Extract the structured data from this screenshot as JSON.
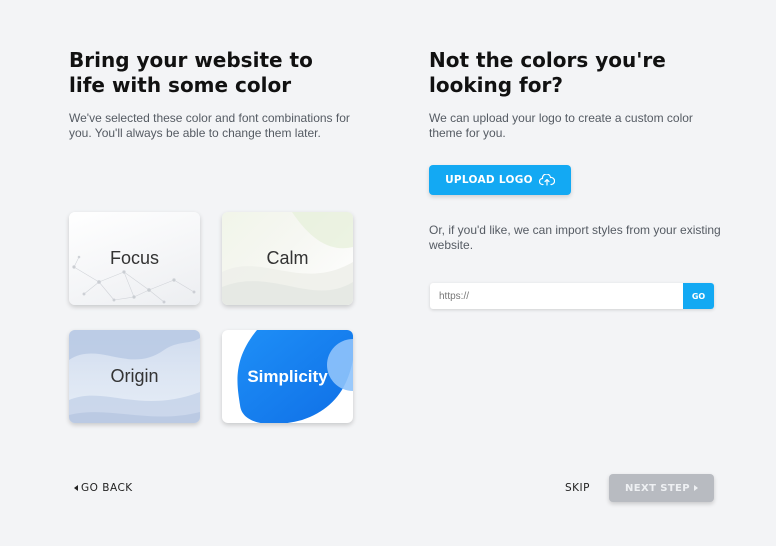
{
  "left": {
    "title": "Bring your website to\nlife with some color",
    "description": "We've selected these color and font combinations for you. You'll always be able to change them later."
  },
  "themes": [
    {
      "label": "Focus"
    },
    {
      "label": "Calm"
    },
    {
      "label": "Origin"
    },
    {
      "label": "Simplicity"
    }
  ],
  "right": {
    "title": "Not the colors you're\nlooking for?",
    "description": "We can upload your logo to create a custom color theme for you.",
    "upload_label": "UPLOAD LOGO",
    "import_text": "Or, if you'd like, we can import styles from your existing website.",
    "url_placeholder": "https://",
    "go_label": "GO"
  },
  "footer": {
    "back_label": "GO BACK",
    "skip_label": "SKIP",
    "next_label": "NEXT STEP"
  },
  "colors": {
    "accent": "#13a9f3",
    "disabled": "#b8bbc1",
    "background": "#f3f4f6"
  },
  "icons": {
    "upload": "cloud-upload-icon",
    "back": "caret-left-icon",
    "next": "caret-right-icon"
  }
}
